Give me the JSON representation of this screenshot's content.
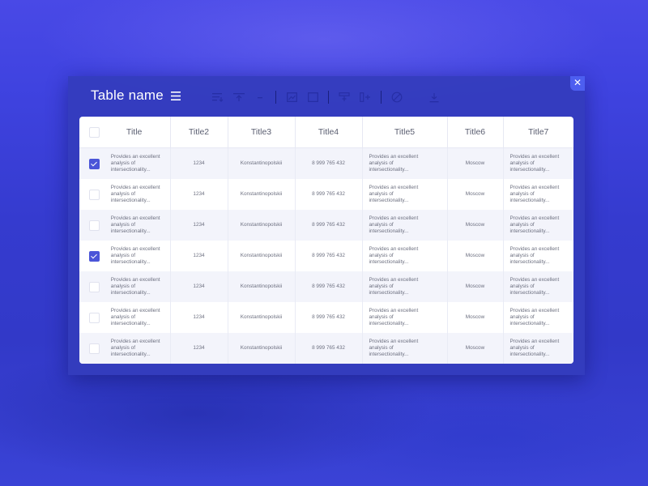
{
  "window": {
    "title": "Table name",
    "close_label": "✕"
  },
  "toolbar": {
    "icons": [
      "sort-icon",
      "insert-row-icon",
      "image-icon",
      "select-icon",
      "split-icon",
      "add-column-icon",
      "hide-icon",
      "download-icon"
    ]
  },
  "table": {
    "columns": [
      "Title",
      "Title2",
      "Title3",
      "Title4",
      "Title5",
      "Title6",
      "Title7"
    ],
    "rows": [
      {
        "checked": true,
        "c1": "Provides an excellent analysis of intersectionality...",
        "c2": "1234",
        "c3": "Konstantinopolskii",
        "c4": "8 999 765 432",
        "c5": "Provides an excellent analysis of intersectionality...",
        "c6": "Moscow",
        "c7": "Provides an excellent analysis of intersectionality..."
      },
      {
        "checked": false,
        "c1": "Provides an excellent analysis of intersectionality...",
        "c2": "1234",
        "c3": "Konstantinopolskii",
        "c4": "8 999 765 432",
        "c5": "Provides an excellent analysis of intersectionality...",
        "c6": "Moscow",
        "c7": "Provides an excellent analysis of intersectionality..."
      },
      {
        "checked": false,
        "c1": "Provides an excellent analysis of intersectionality...",
        "c2": "1234",
        "c3": "Konstantinopolskii",
        "c4": "8 999 765 432",
        "c5": "Provides an excellent analysis of intersectionality...",
        "c6": "Moscow",
        "c7": "Provides an excellent analysis of intersectionality..."
      },
      {
        "checked": true,
        "c1": "Provides an excellent analysis of intersectionality...",
        "c2": "1234",
        "c3": "Konstantinopolskii",
        "c4": "8 999 765 432",
        "c5": "Provides an excellent analysis of intersectionality...",
        "c6": "Moscow",
        "c7": "Provides an excellent analysis of intersectionality..."
      },
      {
        "checked": false,
        "c1": "Provides an excellent analysis of intersectionality...",
        "c2": "1234",
        "c3": "Konstantinopolskii",
        "c4": "8 999 765 432",
        "c5": "Provides an excellent analysis of intersectionality...",
        "c6": "Moscow",
        "c7": "Provides an excellent analysis of intersectionality..."
      },
      {
        "checked": false,
        "c1": "Provides an excellent analysis of intersectionality...",
        "c2": "1234",
        "c3": "Konstantinopolskii",
        "c4": "8 999 765 432",
        "c5": "Provides an excellent analysis of intersectionality...",
        "c6": "Moscow",
        "c7": "Provides an excellent analysis of intersectionality..."
      },
      {
        "checked": false,
        "c1": "Provides an excellent analysis of intersectionality...",
        "c2": "1234",
        "c3": "Konstantinopolskii",
        "c4": "8 999 765 432",
        "c5": "Provides an excellent analysis of intersectionality...",
        "c6": "Moscow",
        "c7": "Provides an excellent analysis of intersectionality..."
      }
    ]
  },
  "colors": {
    "accent": "#4b55d8",
    "window_bg": "#343cbc",
    "close_bg": "#4d5ef0"
  }
}
